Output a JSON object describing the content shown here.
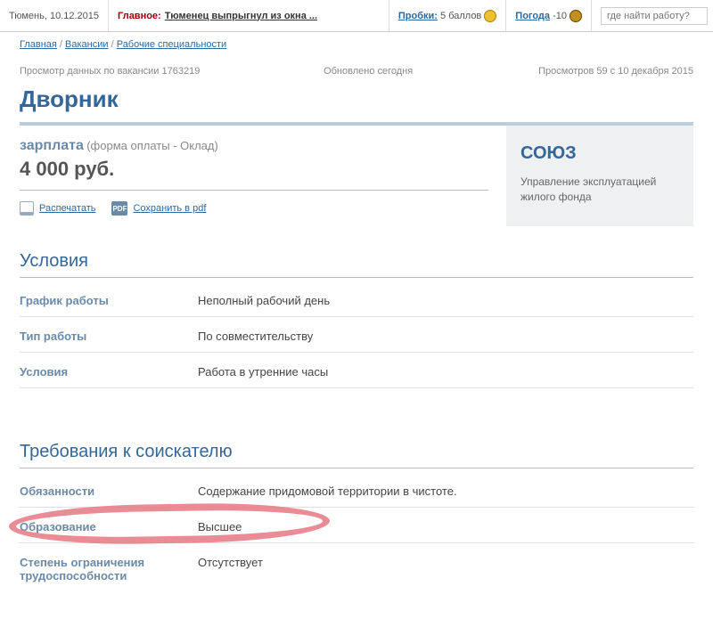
{
  "topbar": {
    "city_date": "Тюмень, 10.12.2015",
    "main_label": "Главное:",
    "main_headline": "Тюменец выпрыгнул из окна ...",
    "traffic_label": "Пробки:",
    "traffic_value": "5 баллов",
    "weather_label": "Погода",
    "weather_value": "-10",
    "search_placeholder": "где найти работу?"
  },
  "breadcrumb": {
    "home": "Главная",
    "vacancies": "Вакансии",
    "category": "Рабочие специальности"
  },
  "meta": {
    "view_label": "Просмотр данных по вакансии 1763219",
    "updated": "Обновлено сегодня",
    "views": "Просмотров 59 с 10 декабря 2015"
  },
  "title": "Дворник",
  "salary": {
    "label": "зарплата",
    "form": "(форма оплаты - Оклад)",
    "amount": "4 000 руб."
  },
  "actions": {
    "print": "Распечатать",
    "pdf_badge": "PDF",
    "pdf": "Сохранить в pdf"
  },
  "company": {
    "name": "СОЮЗ",
    "desc": "Управление эксплуатацией жилого фонда"
  },
  "sections": {
    "conditions_title": "Условия",
    "conditions": [
      {
        "label": "График работы",
        "value": "Неполный рабочий день"
      },
      {
        "label": "Тип работы",
        "value": "По совместительству"
      },
      {
        "label": "Условия",
        "value": "Работа в утренние часы"
      }
    ],
    "requirements_title": "Требования к соискателю",
    "requirements": [
      {
        "label": "Обязанности",
        "value": "Содержание придомовой территории в чистоте."
      },
      {
        "label": "Образование",
        "value": "Высшее"
      },
      {
        "label": "Степень ограничения трудоспособности",
        "value": "Отсутствует"
      }
    ]
  }
}
